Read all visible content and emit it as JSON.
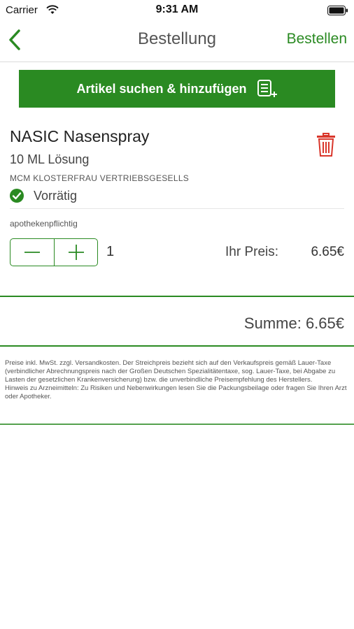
{
  "status_bar": {
    "carrier": "Carrier",
    "time": "9:31 AM"
  },
  "nav": {
    "title": "Bestellung",
    "order_button": "Bestellen"
  },
  "search_add_button": {
    "label": "Artikel suchen & hinzufügen",
    "icon": "list-add-icon"
  },
  "product": {
    "name": "NASIC Nasenspray",
    "form": "10 ML Lösung",
    "manufacturer": "MCM KLOSTERFRAU VERTRIEBSGESELLS",
    "stock_status": "Vorrätig",
    "requirement": "apothekenpflichtig",
    "quantity": "1",
    "price_label": "Ihr Preis:",
    "price": "6.65€"
  },
  "summary": {
    "total": "Summe: 6.65€"
  },
  "disclaimer": {
    "prices": "Preise inkl. MwSt. zzgl. Versandkosten. Der Streichpreis bezieht sich auf den Verkaufspreis gemäß Lauer-Taxe (verbindlicher Abrechnungspreis nach der Großen Deutschen Spezialitätentaxe, sog. Lauer-Taxe, bei Abgabe zu Lasten der gesetzlichen Krankenversicherung) bzw. die unverbindliche Preisempfehlung des Herstellers.",
    "medication_note": "Hinweis zu Arzneimitteln: Zu Risiken und Nebenwirkungen lesen Sie die Packungsbeilage oder fragen Sie Ihren Arzt oder Apotheker."
  },
  "colors": {
    "brand_green": "#2a8a22",
    "delete_red": "#d9362b"
  }
}
